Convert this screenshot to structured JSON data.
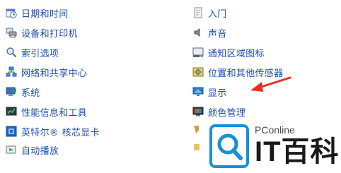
{
  "left_items": [
    {
      "label": "日期和时间",
      "icon": "clock-icon"
    },
    {
      "label": "设备和打印机",
      "icon": "printer-icon"
    },
    {
      "label": "索引选项",
      "icon": "search-index-icon"
    },
    {
      "label": "网络和共享中心",
      "icon": "network-icon"
    },
    {
      "label": "系统",
      "icon": "system-icon"
    },
    {
      "label": "性能信息和工具",
      "icon": "performance-icon"
    },
    {
      "label": "英特尔® 核芯显卡",
      "icon": "intel-graphics-icon"
    },
    {
      "label": "自动播放",
      "icon": "autoplay-icon"
    }
  ],
  "right_items": [
    {
      "label": "入门",
      "icon": "getting-started-icon"
    },
    {
      "label": "声音",
      "icon": "speaker-icon"
    },
    {
      "label": "通知区域图标",
      "icon": "notification-area-icon"
    },
    {
      "label": "位置和其他传感器",
      "icon": "location-sensor-icon"
    },
    {
      "label": "显示",
      "icon": "display-icon"
    },
    {
      "label": "颜色管理",
      "icon": "color-management-icon"
    }
  ],
  "watermark": {
    "small": "PConline",
    "big": "IT百科"
  },
  "colors": {
    "link": "#1e4ea8",
    "arrow": "#e8302a",
    "logo": "#1a8fd8"
  }
}
